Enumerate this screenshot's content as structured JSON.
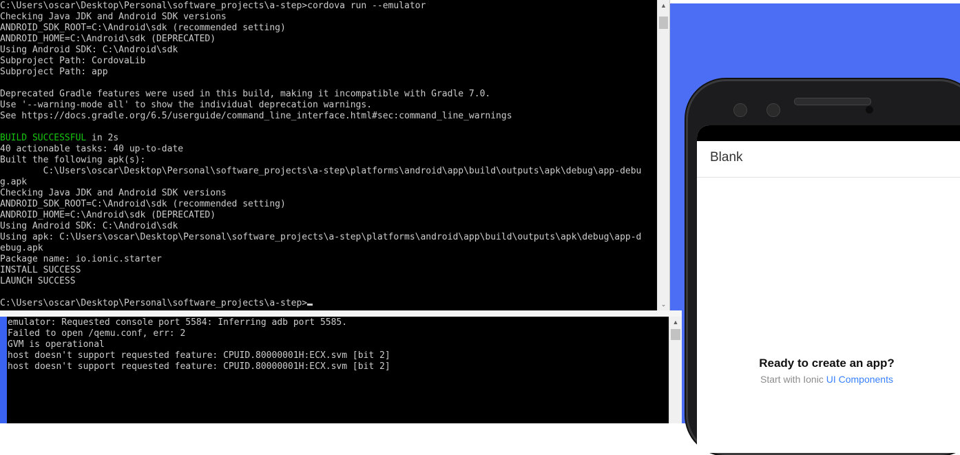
{
  "terminal_main": {
    "lines": [
      {
        "text": "C:\\Users\\oscar\\Desktop\\Personal\\software_projects\\a-step>cordova run --emulator"
      },
      {
        "text": "Checking Java JDK and Android SDK versions"
      },
      {
        "text": "ANDROID_SDK_ROOT=C:\\Android\\sdk (recommended setting)"
      },
      {
        "text": "ANDROID_HOME=C:\\Android\\sdk (DEPRECATED)"
      },
      {
        "text": "Using Android SDK: C:\\Android\\sdk"
      },
      {
        "text": "Subproject Path: CordovaLib"
      },
      {
        "text": "Subproject Path: app"
      },
      {
        "text": ""
      },
      {
        "text": "Deprecated Gradle features were used in this build, making it incompatible with Gradle 7.0."
      },
      {
        "text": "Use '--warning-mode all' to show the individual deprecation warnings."
      },
      {
        "text": "See https://docs.gradle.org/6.5/userguide/command_line_interface.html#sec:command_line_warnings"
      },
      {
        "text": ""
      },
      {
        "green": "BUILD SUCCESSFUL",
        "text": " in 2s"
      },
      {
        "text": "40 actionable tasks: 40 up-to-date"
      },
      {
        "text": "Built the following apk(s):"
      },
      {
        "text": "        C:\\Users\\oscar\\Desktop\\Personal\\software_projects\\a-step\\platforms\\android\\app\\build\\outputs\\apk\\debug\\app-debu"
      },
      {
        "text": "g.apk"
      },
      {
        "text": "Checking Java JDK and Android SDK versions"
      },
      {
        "text": "ANDROID_SDK_ROOT=C:\\Android\\sdk (recommended setting)"
      },
      {
        "text": "ANDROID_HOME=C:\\Android\\sdk (DEPRECATED)"
      },
      {
        "text": "Using Android SDK: C:\\Android\\sdk"
      },
      {
        "text": "Using apk: C:\\Users\\oscar\\Desktop\\Personal\\software_projects\\a-step\\platforms\\android\\app\\build\\outputs\\apk\\debug\\app-d"
      },
      {
        "text": "ebug.apk"
      },
      {
        "text": "Package name: io.ionic.starter"
      },
      {
        "text": "INSTALL SUCCESS"
      },
      {
        "text": "LAUNCH SUCCESS"
      },
      {
        "text": ""
      },
      {
        "text": "C:\\Users\\oscar\\Desktop\\Personal\\software_projects\\a-step>"
      }
    ]
  },
  "terminal_emulator": {
    "lines": [
      "emulator: Requested console port 5584: Inferring adb port 5585.",
      "Failed to open /qemu.conf, err: 2",
      "GVM is operational",
      "host doesn't support requested feature: CPUID.80000001H:ECX.svm [bit 2]",
      "host doesn't support requested feature: CPUID.80000001H:ECX.svm [bit 2]"
    ]
  },
  "emulator_app": {
    "toolbar_title": "Blank",
    "empty_heading": "Ready to create an app?",
    "empty_sub_prefix": "Start with Ionic ",
    "empty_sub_link": "UI Components",
    "link_color": "#3880ff"
  },
  "colors": {
    "terminal_bg": "#000000",
    "terminal_text": "#cccccc",
    "success_green": "#16c60c",
    "desktop_blue": "#4c6ef5"
  }
}
